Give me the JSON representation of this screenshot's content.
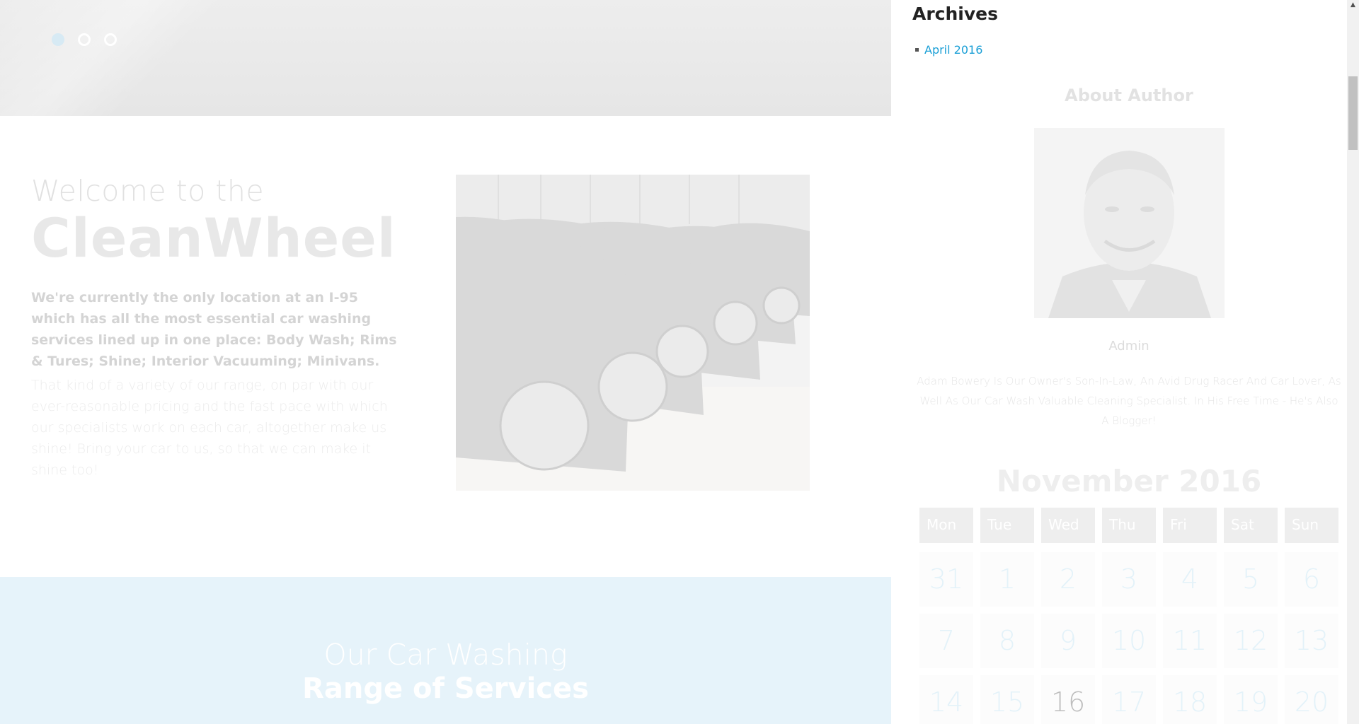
{
  "slider": {
    "dots": 3,
    "active_index": 0
  },
  "welcome": {
    "line1": "Welcome to the",
    "brand": "CleanWheel",
    "lead": "We're currently the only location at an I-95 which has all the most essential car washing services lined up in one place: Body Wash; Rims & Tures; Shine; Interior Vacuuming; Minivans.",
    "body": "That kind of a variety of our range, on par with our ever-reasonable pricing and the fast pace with which our specialists work on each car, altogether make us shine! Bring your car to us, so that we can make it shine too!"
  },
  "services": {
    "subtitle": "Our Car Washing",
    "title": "Range of Services"
  },
  "sidebar": {
    "archives_title": "Archives",
    "archives": [
      {
        "label": "April 2016"
      }
    ],
    "about_title": "About Author",
    "author_name": "Admin",
    "author_bio": "Adam Bowery Is Our Owner's Son-In-Law, An Avid Drug Racer And Car Lover, As Well As Our Car Wash Valuable Cleaning Specialist. In His Free Time - He's Also A Blogger!",
    "calendar": {
      "title": "November 2016",
      "days": [
        "Mon",
        "Tue",
        "Wed",
        "Thu",
        "Fri",
        "Sat",
        "Sun"
      ],
      "dates": [
        "31",
        "1",
        "2",
        "3",
        "4",
        "5",
        "6",
        "7",
        "8",
        "9",
        "10",
        "11",
        "12",
        "13",
        "14",
        "15",
        "16",
        "17",
        "18",
        "19",
        "20"
      ],
      "today": "16"
    }
  },
  "colors": {
    "link": "#1a9fd6",
    "services_bg": "#e6f3fa",
    "dot_active": "#d7eaf4"
  },
  "icons": {
    "scroll_up": "scroll-up-arrow-icon",
    "archive_bullet": "square-bullet-icon"
  }
}
